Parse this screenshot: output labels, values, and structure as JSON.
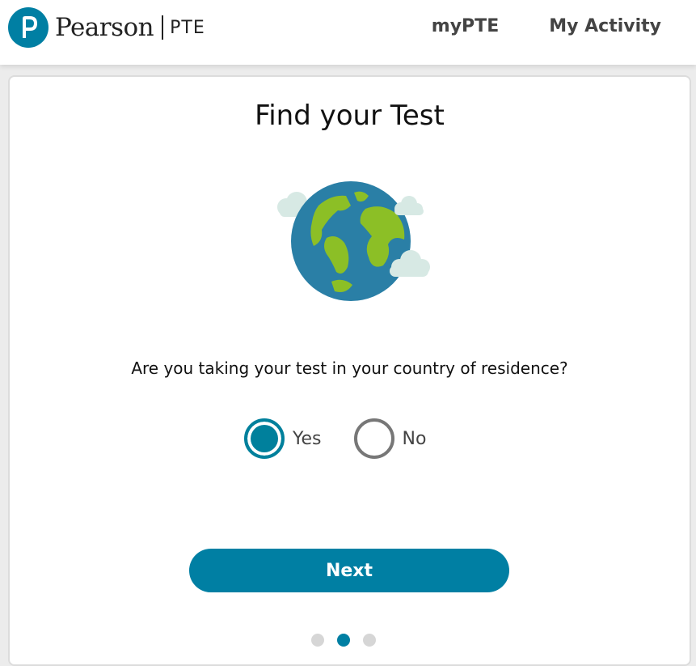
{
  "header": {
    "brand": "Pearson",
    "product": "PTE",
    "nav": [
      "myPTE",
      "My Activity"
    ]
  },
  "main": {
    "title": "Find your Test",
    "question": "Are you taking your test in your country of residence?",
    "options": [
      {
        "label": "Yes",
        "selected": true
      },
      {
        "label": "No",
        "selected": false
      }
    ],
    "next_label": "Next",
    "steps": {
      "total": 3,
      "current": 2
    }
  },
  "colors": {
    "accent": "#007fa3",
    "ocean": "#2a7fa6",
    "land": "#8cbf26",
    "cloud": "#d7e9e4"
  },
  "icons": [
    "pearson-logo-icon",
    "globe-icon",
    "cloud-icon"
  ]
}
